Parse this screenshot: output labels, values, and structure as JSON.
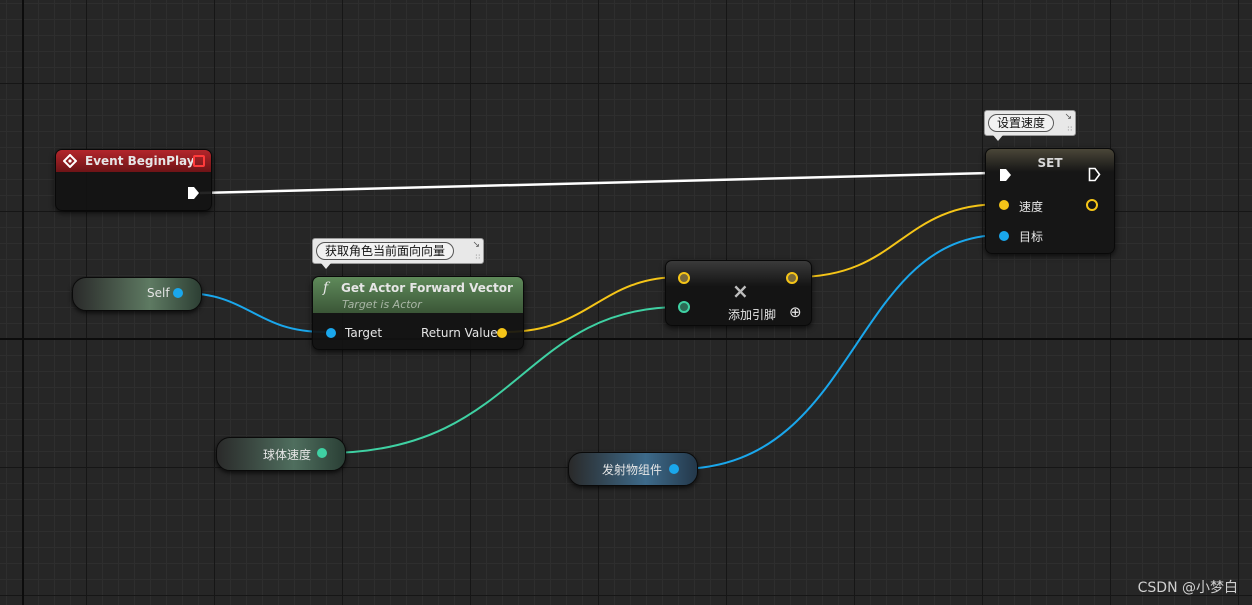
{
  "graph": {
    "event_node": {
      "title": "Event BeginPlay"
    },
    "self_node": {
      "label": "Self"
    },
    "forward_node": {
      "comment": "获取角色当前面向向量",
      "function_icon": "f",
      "title": "Get Actor Forward Vector",
      "subtitle": "Target is Actor",
      "target_label": "Target",
      "return_label": "Return Value"
    },
    "add_node": {
      "operator_icon": "×",
      "add_pin_label": "添加引脚",
      "add_pin_icon": "⊕"
    },
    "set_node": {
      "comment": "设置速度",
      "title": "SET",
      "speed_label": "速度",
      "target_label": "目标"
    },
    "sphere_speed_node": {
      "label": "球体速度"
    },
    "projectile_node": {
      "label": "发射物组件"
    }
  },
  "pin_colors": {
    "exec": "#ffffff",
    "object": "#1aa7ec",
    "vector": "#f5c518",
    "float": "#3fd1a3",
    "event_header": "#8d1f22",
    "function_header": "#4b6a48"
  },
  "icons": {
    "event": "event-diamond-icon",
    "delegate": "delegate-square-icon",
    "function": "function-icon",
    "multiply": "multiply-icon",
    "add_pin": "add-pin-icon",
    "comment_pin": "pushpin-icon"
  },
  "watermark": "CSDN @小梦白"
}
